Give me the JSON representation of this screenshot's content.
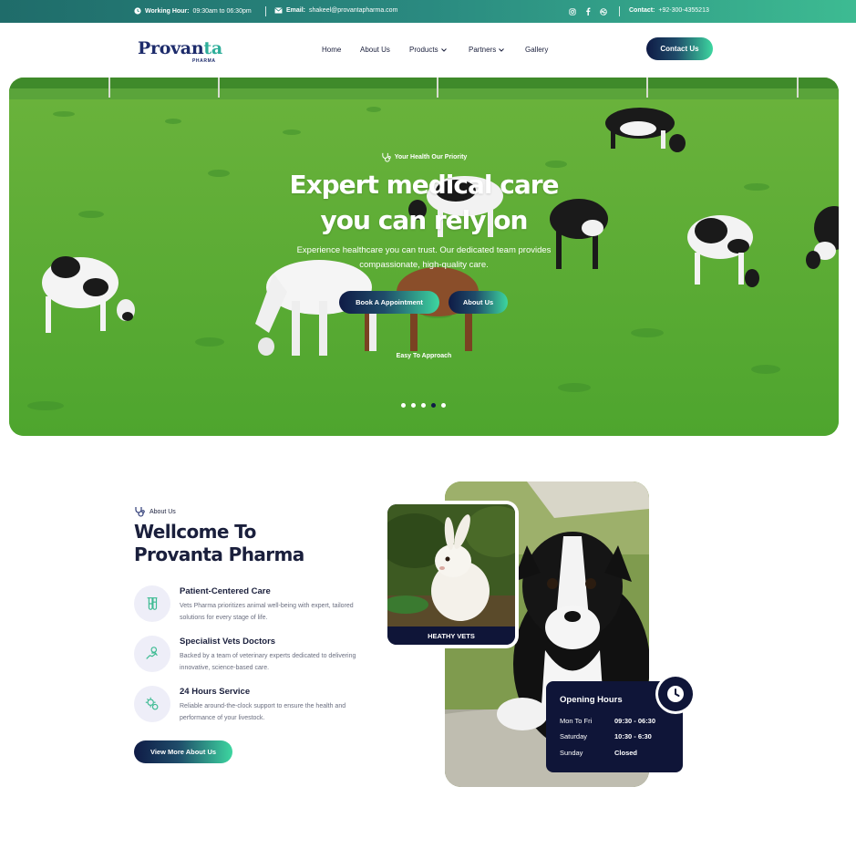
{
  "topbar": {
    "working_label": "Working Hour:",
    "working_value": "09:30am to 06:30pm",
    "email_label": "Email:",
    "email_value": "shakeel@provantapharma.com",
    "contact_label": "Contact:",
    "contact_value": "+92-300-4355213",
    "social_icons": [
      "instagram-icon",
      "facebook-icon",
      "dribbble-icon"
    ]
  },
  "brand": {
    "logo_main": "Provan",
    "logo_accent": "ta",
    "logo_sub": "PHARMA"
  },
  "nav": {
    "items": [
      {
        "label": "Home",
        "has_dropdown": false
      },
      {
        "label": "About Us",
        "has_dropdown": false
      },
      {
        "label": "Products",
        "has_dropdown": true
      },
      {
        "label": "Partners",
        "has_dropdown": true
      },
      {
        "label": "Gallery",
        "has_dropdown": false
      }
    ],
    "cta": "Contact Us"
  },
  "hero": {
    "tagline": "Your Health Our Priority",
    "title_line1": "Expert medical care",
    "title_line2": "you can rely on",
    "lead": "Experience healthcare you can trust. Our dedicated team provides compassionate, high-quality care.",
    "primary_button": "Book A Appointment",
    "secondary_button": "About Us",
    "sub_caption": "Easy To Approach",
    "slides": 5,
    "active_slide": 4
  },
  "about": {
    "tag": "About Us",
    "title_line1": "Wellcome To",
    "title_line2": "Provanta Pharma",
    "features": [
      {
        "title": "Patient-Centered Care",
        "desc": "Vets Pharma prioritizes animal well-being with expert, tailored solutions for every stage of life.",
        "icon": "test-tubes-icon"
      },
      {
        "title": "Specialist Vets Doctors",
        "desc": "Backed by a team of veterinary experts dedicated to delivering innovative, science-based care.",
        "icon": "doctor-hand-icon"
      },
      {
        "title": "24 Hours Service",
        "desc": "Reliable around-the-clock support to ensure the health and performance of your livestock.",
        "icon": "virus-icon"
      }
    ],
    "button": "View More About Us"
  },
  "gallery": {
    "rabbit_label": "HEATHY VETS"
  },
  "hours": {
    "title": "Opening Hours",
    "rows": [
      {
        "day": "Mon To Fri",
        "time": "09:30 - 06:30"
      },
      {
        "day": "Saturday",
        "time": "10:30 - 6:30"
      },
      {
        "day": "Sunday",
        "time": "Closed"
      }
    ]
  },
  "colors": {
    "navy": "#0f1538",
    "teal": "#2fae9a",
    "mint": "#3dd6a0",
    "topbar_start": "#1f6c6a",
    "topbar_end": "#3dbb92"
  }
}
